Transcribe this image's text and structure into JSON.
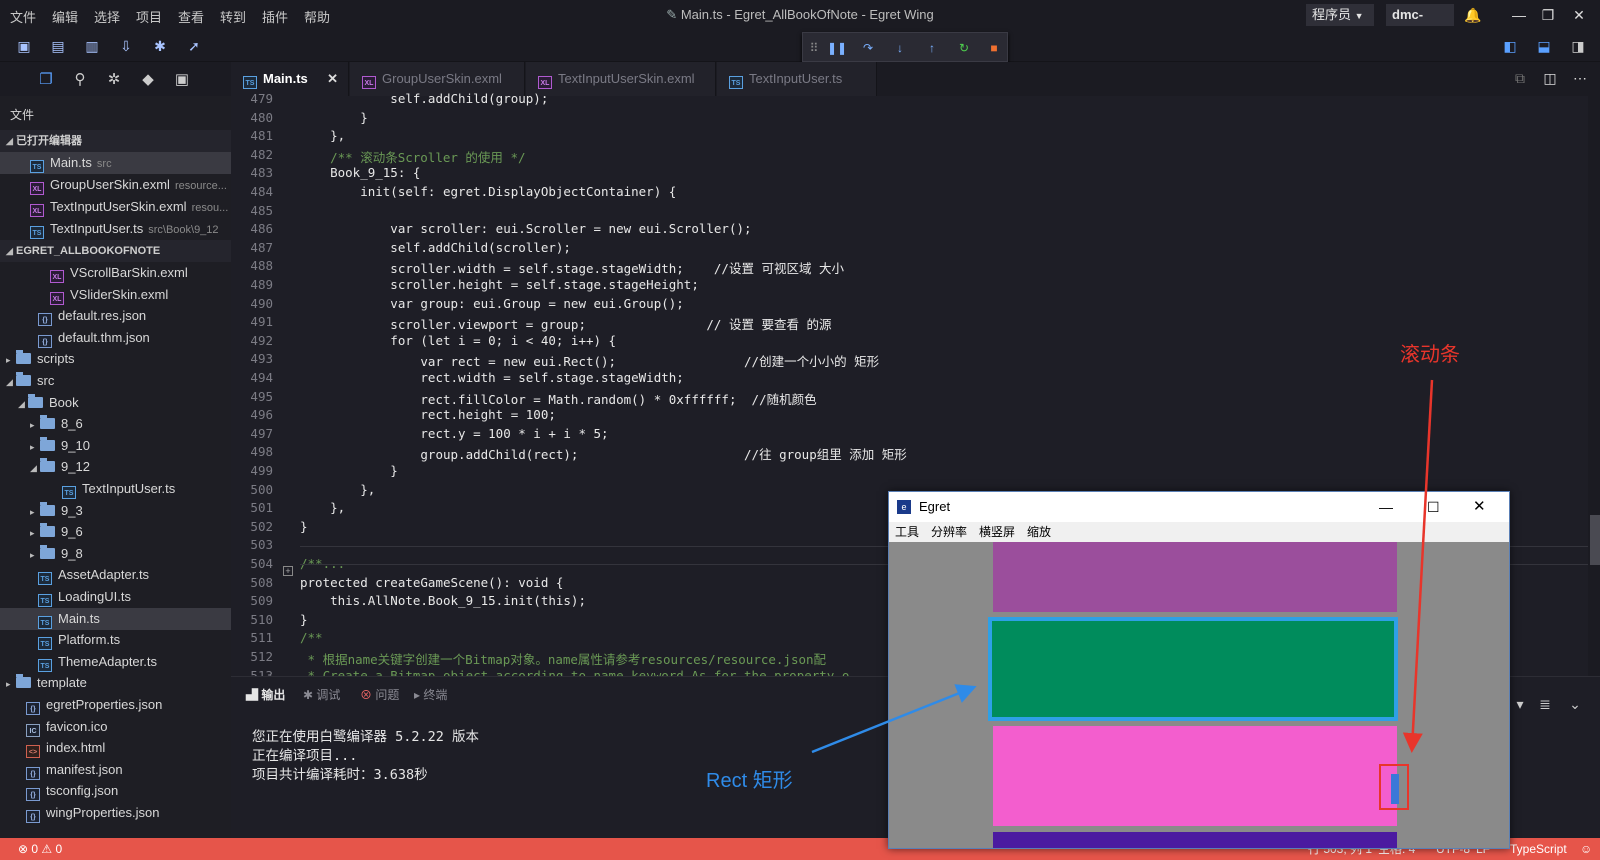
{
  "menubar": [
    "文件",
    "编辑",
    "选择",
    "项目",
    "查看",
    "转到",
    "插件",
    "帮助"
  ],
  "window_title": "Main.ts - Egret_AllBookOfNote - Egret Wing",
  "role": "程序员",
  "user": "dmc-nero",
  "sidebar": {
    "header": "文件",
    "open_editors_title": "已打开编辑器",
    "open_editors": [
      {
        "name": "Main.ts",
        "desc": "src",
        "type": "ts"
      },
      {
        "name": "GroupUserSkin.exml",
        "desc": "resource...",
        "type": "xml"
      },
      {
        "name": "TextInputUserSkin.exml",
        "desc": "resou...",
        "type": "xml"
      },
      {
        "name": "TextInputUser.ts",
        "desc": "src\\Book\\9_12",
        "type": "ts"
      }
    ],
    "project_title": "EGRET_ALLBOOKOFNOTE",
    "tree": [
      {
        "name": "VScrollBarSkin.exml",
        "type": "xml"
      },
      {
        "name": "VSliderSkin.exml",
        "type": "xml"
      },
      {
        "name": "default.res.json",
        "type": "json"
      },
      {
        "name": "default.thm.json",
        "type": "json"
      },
      {
        "name": "scripts",
        "type": "folder"
      },
      {
        "name": "src",
        "type": "folder"
      },
      {
        "name": "Book",
        "type": "folder"
      },
      {
        "name": "8_6",
        "type": "folder"
      },
      {
        "name": "9_10",
        "type": "folder"
      },
      {
        "name": "9_12",
        "type": "folder"
      },
      {
        "name": "TextInputUser.ts",
        "type": "ts"
      },
      {
        "name": "9_3",
        "type": "folder"
      },
      {
        "name": "9_6",
        "type": "folder"
      },
      {
        "name": "9_8",
        "type": "folder"
      },
      {
        "name": "AssetAdapter.ts",
        "type": "ts"
      },
      {
        "name": "LoadingUI.ts",
        "type": "ts"
      },
      {
        "name": "Main.ts",
        "type": "ts"
      },
      {
        "name": "Platform.ts",
        "type": "ts"
      },
      {
        "name": "ThemeAdapter.ts",
        "type": "ts"
      },
      {
        "name": "template",
        "type": "folder"
      },
      {
        "name": "egretProperties.json",
        "type": "json"
      },
      {
        "name": "favicon.ico",
        "type": "ico"
      },
      {
        "name": "index.html",
        "type": "html"
      },
      {
        "name": "manifest.json",
        "type": "json"
      },
      {
        "name": "tsconfig.json",
        "type": "json"
      },
      {
        "name": "wingProperties.json",
        "type": "json"
      }
    ]
  },
  "tabs": [
    "Main.ts",
    "GroupUserSkin.exml",
    "TextInputUserSkin.exml",
    "TextInputUser.ts"
  ],
  "code_lines": [
    {
      "n": "479",
      "t": "            self.addChild(group);"
    },
    {
      "n": "480",
      "t": "        }"
    },
    {
      "n": "481",
      "t": "    },"
    },
    {
      "n": "482",
      "t": "    /** 滚动条Scroller 的使用 */"
    },
    {
      "n": "483",
      "t": "    Book_9_15: {"
    },
    {
      "n": "484",
      "t": "        init(self: egret.DisplayObjectContainer) {"
    },
    {
      "n": "485",
      "t": ""
    },
    {
      "n": "486",
      "t": "            var scroller: eui.Scroller = new eui.Scroller();"
    },
    {
      "n": "487",
      "t": "            self.addChild(scroller);"
    },
    {
      "n": "488",
      "t": "            scroller.width = self.stage.stageWidth;    //设置 可视区域 大小"
    },
    {
      "n": "489",
      "t": "            scroller.height = self.stage.stageHeight;"
    },
    {
      "n": "490",
      "t": "            var group: eui.Group = new eui.Group();"
    },
    {
      "n": "491",
      "t": "            scroller.viewport = group;                // 设置 要查看 的源"
    },
    {
      "n": "492",
      "t": "            for (let i = 0; i < 40; i++) {"
    },
    {
      "n": "493",
      "t": "                var rect = new eui.Rect();                 //创建一个小小的 矩形"
    },
    {
      "n": "494",
      "t": "                rect.width = self.stage.stageWidth;"
    },
    {
      "n": "495",
      "t": "                rect.fillColor = Math.random() * 0xffffff;  //随机颜色"
    },
    {
      "n": "496",
      "t": "                rect.height = 100;"
    },
    {
      "n": "497",
      "t": "                rect.y = 100 * i + i * 5;"
    },
    {
      "n": "498",
      "t": "                group.addChild(rect);                      //往 group组里 添加 矩形"
    },
    {
      "n": "499",
      "t": "            }"
    },
    {
      "n": "500",
      "t": "        },"
    },
    {
      "n": "501",
      "t": "    },"
    },
    {
      "n": "502",
      "t": "}"
    },
    {
      "n": "503",
      "t": ""
    },
    {
      "n": "504",
      "t": "/**..."
    },
    {
      "n": "508",
      "t": "protected createGameScene(): void {"
    },
    {
      "n": "509",
      "t": "    this.AllNote.Book_9_15.init(this);"
    },
    {
      "n": "510",
      "t": "}"
    },
    {
      "n": "511",
      "t": "/**"
    },
    {
      "n": "512",
      "t": " * 根据name关键字创建一个Bitmap对象。name属性请参考resources/resource.json配"
    },
    {
      "n": "513",
      "t": " * Create a Bitmap object according to name keyword.As for the property o"
    }
  ],
  "panel": {
    "tabs": [
      "输出",
      "调试",
      "问题",
      "终端"
    ],
    "lines": [
      "您正在使用白鹭编译器 5.2.22 版本",
      "正在编译项目...",
      "项目共计编译耗时：3.638秒"
    ]
  },
  "status": {
    "errors": "0",
    "warnings": "0",
    "position": "行 503, 列 1",
    "spaces": "空格: 4",
    "encoding": "UTF-8",
    "eol": "LF",
    "language": "TypeScript"
  },
  "egret_window": {
    "title": "Egret",
    "menu": [
      "工具",
      "分辨率",
      "横竖屏",
      "缩放"
    ]
  },
  "annotations": {
    "scrollbar_label": "滚动条",
    "rect_label": "Rect 矩形"
  },
  "colors": {
    "rect1": "#9b4e9c",
    "rect2": "#008c5c",
    "rect3": "#f35ece",
    "rect4": "#4b1aa0",
    "highlight": "#2ea0e6",
    "annot_red": "#e8352b",
    "annot_blue": "#2f8be8",
    "status_bg": "#e6554a"
  }
}
